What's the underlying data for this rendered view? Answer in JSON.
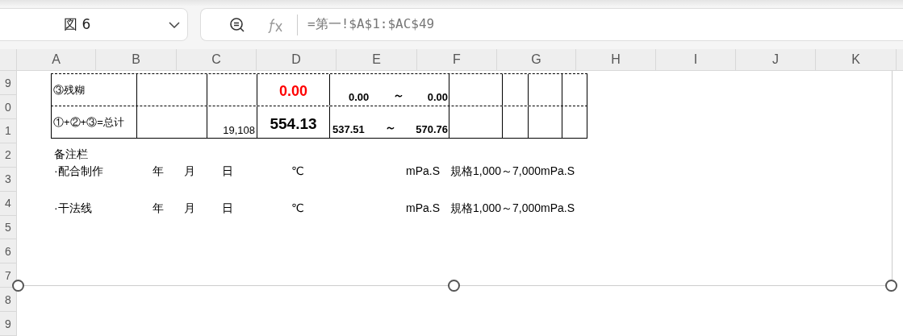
{
  "name_box": {
    "value": "図 6"
  },
  "formula_bar": {
    "formula": "=第一!$A$1:$AC$49"
  },
  "columns": [
    "A",
    "B",
    "C",
    "D",
    "E",
    "F",
    "G",
    "H",
    "I",
    "J",
    "K"
  ],
  "rows": [
    "9",
    "0",
    "1",
    "2",
    "3",
    "4",
    "5",
    "6",
    "7",
    "8",
    "9"
  ],
  "picture_object": {
    "table": [
      {
        "label": "③残糊",
        "total": "0.00",
        "alert": true,
        "range_low": "0.00",
        "separator": "～",
        "range_high": "0.00"
      },
      {
        "label": "①+②+③=总计",
        "count": "19,108",
        "total": "554.13",
        "alert": false,
        "range_low": "537.51",
        "separator": "～",
        "range_high": "570.76"
      }
    ],
    "notes": {
      "title": "备注栏",
      "lines": [
        {
          "cells": [
            "·配合制作",
            "年",
            "月",
            "日",
            "℃",
            "mPa.S",
            "規格1,000～7,000mPa.S"
          ]
        },
        {
          "cells": [
            "·干法线",
            "年",
            "月",
            "日",
            "℃",
            "mPa.S",
            "規格1,000～7,000mPa.S"
          ]
        }
      ]
    }
  }
}
